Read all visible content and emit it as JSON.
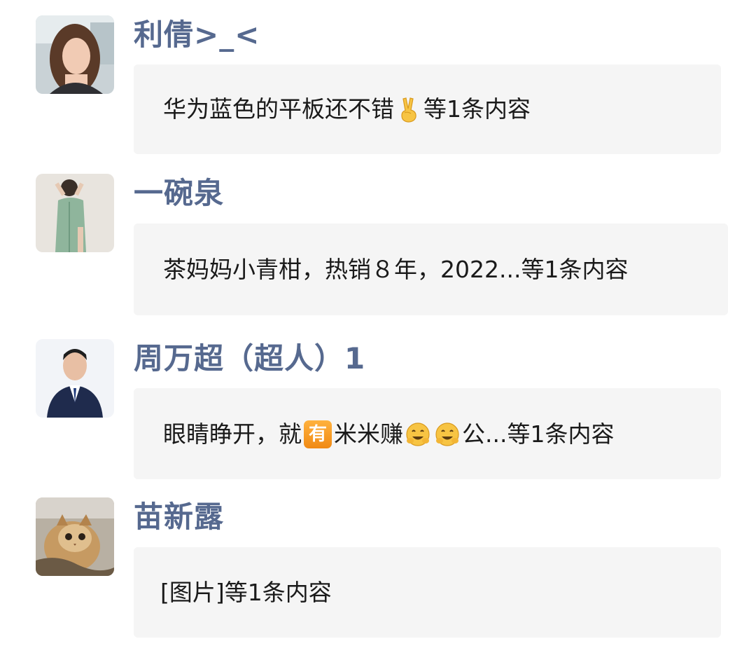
{
  "entries": [
    {
      "name": "利倩>_<",
      "preview": {
        "text_before": "华为蓝色的平板还不错",
        "emoji_1": "victory-hand-icon",
        "text_after": "等1条内容"
      }
    },
    {
      "name": "一碗泉",
      "preview": {
        "text": "茶妈妈小青柑，热销８年，2022...等1条内容"
      }
    },
    {
      "name": "周万超（超人）1",
      "preview": {
        "text_before": "眼睛睁开，就",
        "badge": "有",
        "text_middle": "米米赚",
        "emoji_1": "smiling-face-icon",
        "emoji_2": "smiling-face-icon",
        "text_after": " 公...等1条内容"
      }
    },
    {
      "name": "苗新露",
      "preview": {
        "text": "[图片]等1条内容"
      }
    }
  ],
  "colors": {
    "name": "#56698f",
    "bubble_bg": "#f5f5f5",
    "preview_text": "#1a1a1a",
    "badge_bg": "#f5a023"
  }
}
